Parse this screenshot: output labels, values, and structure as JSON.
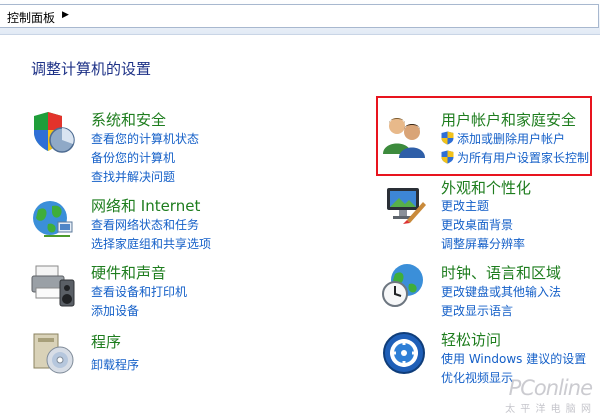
{
  "window": {
    "breadcrumb": "控制面板"
  },
  "page": {
    "title": "调整计算机的设置"
  },
  "categories": {
    "system": {
      "title": "系统和安全",
      "links": [
        "查看您的计算机状态",
        "备份您的计算机",
        "查找并解决问题"
      ],
      "icon": "shield-pie-chart-icon"
    },
    "network": {
      "title": "网络和 Internet",
      "links": [
        "查看网络状态和任务",
        "选择家庭组和共享选项"
      ],
      "icon": "globe-network-icon"
    },
    "hardware": {
      "title": "硬件和声音",
      "links": [
        "查看设备和打印机",
        "添加设备"
      ],
      "icon": "printer-speaker-icon"
    },
    "programs": {
      "title": "程序",
      "links": [
        "卸载程序"
      ],
      "icon": "programs-disc-icon"
    },
    "users": {
      "title": "用户帐户和家庭安全",
      "links": [
        "添加或删除用户帐户",
        "为所有用户设置家长控制"
      ],
      "icon": "users-icon"
    },
    "appearance": {
      "title": "外观和个性化",
      "links": [
        "更改主题",
        "更改桌面背景",
        "调整屏幕分辨率"
      ],
      "icon": "display-paintbrush-icon"
    },
    "clock": {
      "title": "时钟、语言和区域",
      "links": [
        "更改键盘或其他输入法",
        "更改显示语言"
      ],
      "icon": "clock-globe-icon"
    },
    "ease": {
      "title": "轻松访问",
      "links": [
        "使用 Windows 建议的设置",
        "优化视频显示"
      ],
      "icon": "ease-of-access-icon"
    }
  },
  "colors": {
    "category_title": "#1e7d1e",
    "link": "#1560c8",
    "highlight_border": "#e8141e"
  },
  "watermark": {
    "main": "PConline",
    "sub": "太 平 洋 电 脑 网"
  }
}
